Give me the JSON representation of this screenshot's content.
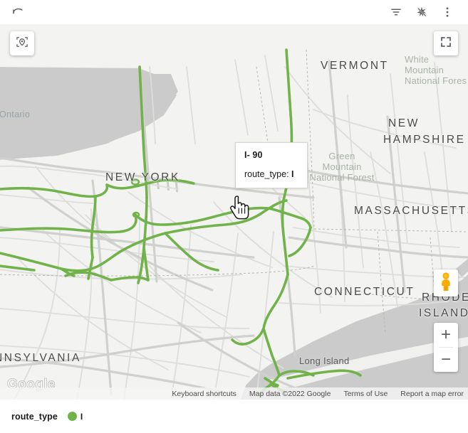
{
  "toolbar": {
    "undo_label": "Undo",
    "icons": [
      {
        "name": "undo-icon",
        "label": "Undo"
      },
      {
        "name": "filter-icon",
        "label": "Filter"
      },
      {
        "name": "clear-formatting-icon",
        "label": "Clear"
      },
      {
        "name": "more-options-icon",
        "label": "More options"
      }
    ]
  },
  "map": {
    "controls": {
      "locate": "Zoom to data",
      "fullscreen": "Toggle fullscreen view",
      "pegman": "Drag Pegman onto the map to open Street View",
      "zoom_in": "+",
      "zoom_out": "−"
    },
    "labels": {
      "vermont": "VERMONT",
      "new_hampshire_1": "NEW",
      "new_hampshire_2": "HAMPSHIRE",
      "new_york": "NEW YORK",
      "massachusetts": "MASSACHUSETTS",
      "connecticut": "CONNECTICUT",
      "rhode_island_1": "RHODE",
      "rhode_island_2": "ISLAND",
      "pennsylvania": "NNSYLVANIA",
      "lake_ontario": "e Ontario",
      "white_mountain": "White\nMountain\nNational Fores",
      "green_mountain": "Green\nMountain\nNational Forest",
      "long_island": "Long Island"
    },
    "watermark": "Google",
    "attribution": {
      "keyboard_shortcuts": "Keyboard shortcuts",
      "map_data": "Map data ©2022 Google",
      "terms": "Terms of Use",
      "report": "Report a map error"
    }
  },
  "tooltip": {
    "title": "I- 90",
    "field_label": "route_type:",
    "field_value": "I"
  },
  "legend": {
    "title": "route_type",
    "items": [
      {
        "label": "I",
        "color": "#71b34a"
      }
    ]
  },
  "colors": {
    "route_green": "#71b34a",
    "map_land": "#f3f3f1",
    "map_water": "#cbcbcb",
    "road": "#d8d8d6",
    "accent_pegman": "#f9ab00"
  }
}
